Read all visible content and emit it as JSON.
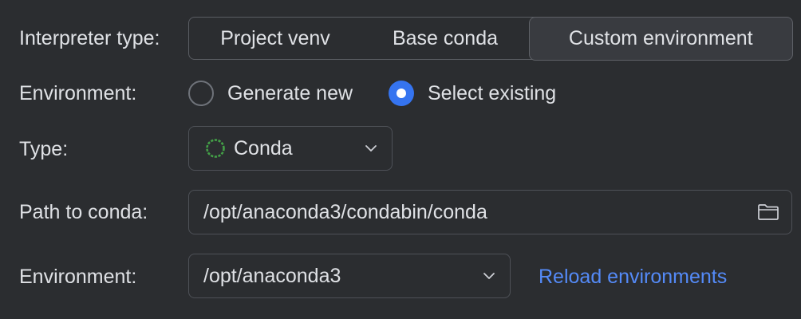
{
  "interpreter_type": {
    "label": "Interpreter type:",
    "options": [
      "Project venv",
      "Base conda",
      "Custom environment"
    ],
    "selected": "Custom environment"
  },
  "environment_mode": {
    "label": "Environment:",
    "options": [
      {
        "label": "Generate new",
        "checked": false
      },
      {
        "label": "Select existing",
        "checked": true
      }
    ]
  },
  "type": {
    "label": "Type:",
    "value": "Conda",
    "icon": "conda-ring-icon"
  },
  "path_to_conda": {
    "label": "Path to conda:",
    "value": "/opt/anaconda3/condabin/conda",
    "icon": "folder-icon"
  },
  "environment": {
    "label": "Environment:",
    "value": "/opt/anaconda3",
    "reload_link": "Reload environments"
  },
  "colors": {
    "background": "#2b2d30",
    "text": "#dfe1e5",
    "accent": "#3574f0",
    "link": "#548af7",
    "conda_green": "#43a047"
  }
}
